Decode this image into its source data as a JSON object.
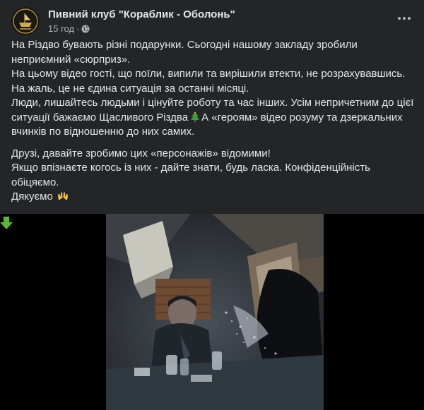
{
  "post": {
    "page_name": "Пивний клуб \"Кораблик - Оболонь\"",
    "time": "15 год",
    "dot": "·",
    "paragraph1": [
      "На Різдво бувають різні подарунки. Сьогодні нашому закладу зробили неприємний «сюрприз».",
      "На цьому відео гості, що поїли, випили та вирішили втекти, не розрахувавшись.",
      "На жаль, це не єдина ситуація за останні місяці.",
      "Люди, лишайтесь людьми і цінуйте роботу та час інших. Усім непричетним до цієї ситуації бажаємо Щасливого Різдва",
      "А «героям» відео розуму та дзеркальних вчинків по відношенню до них самих."
    ],
    "paragraph2": [
      "Друзі, давайте зробимо цих «персонажів» відомими!",
      "Якщо впізнаєте когось із них - дайте знати, будь ласка. Конфіденційність обіцяємо.",
      "Дякуємо"
    ]
  },
  "icons": {
    "avatar": "club-logo",
    "privacy": "globe-icon",
    "more": "more-options-icon",
    "tree": "christmas-tree-emoji",
    "hands": "raised-hands-emoji",
    "arrow": "green-down-arrow-icon"
  },
  "colors": {
    "background": "#242526",
    "text": "#e4e6eb",
    "secondary_text": "#b0b3b8",
    "video_background": "#000000",
    "arrow": "#5cb82f"
  }
}
